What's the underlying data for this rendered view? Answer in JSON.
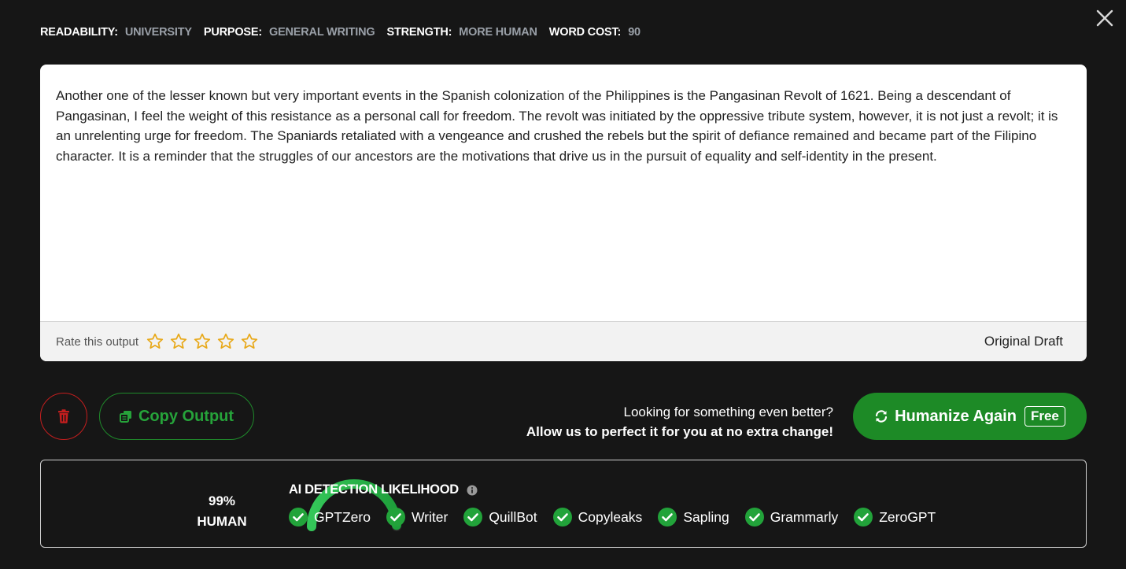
{
  "meta": {
    "readability_label": "READABILITY:",
    "readability_value": "UNIVERSITY",
    "purpose_label": "PURPOSE:",
    "purpose_value": "GENERAL WRITING",
    "strength_label": "STRENGTH:",
    "strength_value": "MORE HUMAN",
    "word_cost_label": "WORD COST:",
    "word_cost_value": "90"
  },
  "output": {
    "text": "Another one of the lesser known but very important events in the Spanish colonization of the Philippines is the Pangasinan Revolt of 1621. Being a descendant of Pangasinan, I feel the weight of this resistance as a personal call for freedom. The revolt was initiated by the oppressive tribute system, however, it is not just a revolt; it is an unrelenting urge for freedom. The Spaniards retaliated with a vengeance and crushed the rebels but the spirit of defiance remained and became part of the Filipino character. It is a reminder that the struggles of our ancestors are the motivations that drive us in the pursuit of equality and self-identity in the present.",
    "rate_label": "Rate this output",
    "stars_total": 5,
    "draft_label": "Original Draft"
  },
  "actions": {
    "copy_label": "Copy Output",
    "promo_line1": "Looking for something even better?",
    "promo_line2": "Allow us to perfect it for you at no extra change!",
    "humanize_label": "Humanize Again",
    "free_label": "Free"
  },
  "detection": {
    "percent_text": "99%",
    "percent_value": 99,
    "label": "HUMAN",
    "title": "AI DETECTION LIKELIHOOD",
    "detectors": [
      "GPTZero",
      "Writer",
      "QuillBot",
      "Copyleaks",
      "Sapling",
      "Grammarly",
      "ZeroGPT"
    ]
  },
  "colors": {
    "background": "#161616",
    "accent_green": "#1d8a26",
    "danger_red": "#c41e1e",
    "star_gold": "#e8a817",
    "meta_value": "#9aa0a8"
  },
  "icons": {
    "close": "close-icon",
    "star": "star-outline-icon",
    "trash": "trash-icon",
    "copy": "copy-icon",
    "refresh": "refresh-icon",
    "info": "info-icon",
    "check": "check-circle-icon"
  }
}
